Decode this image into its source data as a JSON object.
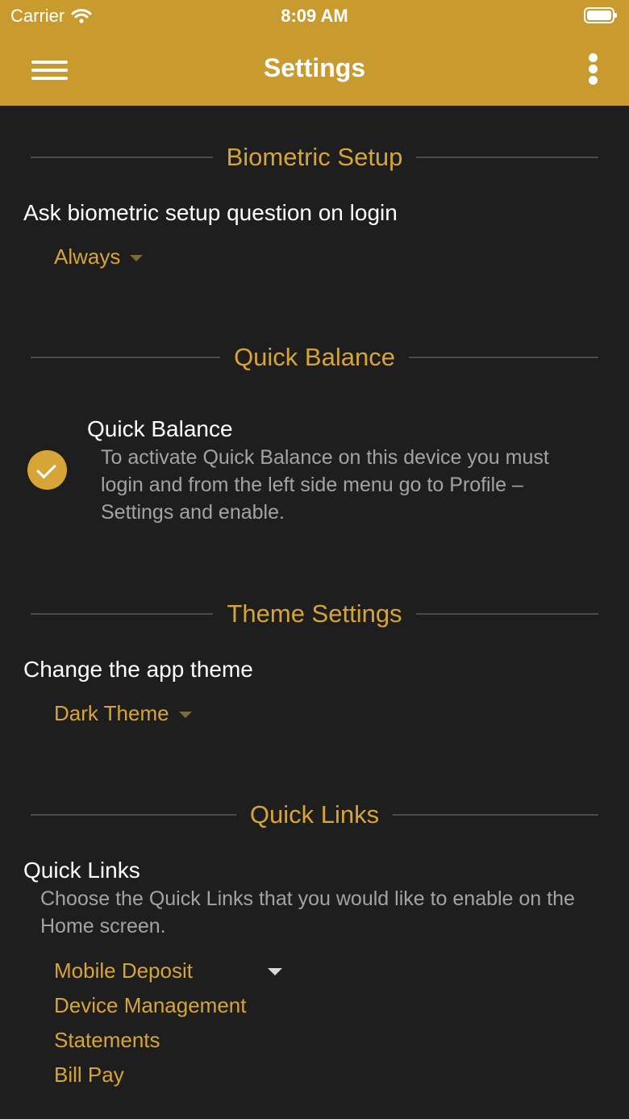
{
  "status_bar": {
    "carrier": "Carrier",
    "time": "8:09 AM"
  },
  "header": {
    "title": "Settings",
    "icons": [
      "hamburger-menu-icon",
      "more-vertical-icon"
    ]
  },
  "colors": {
    "header_bg": "#c99a2e",
    "accent": "#d6a437",
    "page_bg": "#1e1e1e"
  },
  "sections": {
    "biometric": {
      "heading": "Biometric Setup",
      "label": "Ask biometric setup question on login",
      "selected": "Always"
    },
    "quick_balance": {
      "heading": "Quick Balance",
      "item_title": "Quick Balance",
      "description": "To activate Quick Balance on this device you must login and from the left side menu go to Profile – Settings and enable.",
      "checked": true
    },
    "theme": {
      "heading": "Theme Settings",
      "label": "Change the app theme",
      "selected": "Dark Theme"
    },
    "quick_links": {
      "heading": "Quick Links",
      "label": "Quick Links",
      "description": "Choose the Quick Links that you would like to enable on the Home screen.",
      "options": [
        "Mobile Deposit",
        "Device Management",
        "Statements",
        "Bill Pay"
      ]
    }
  }
}
